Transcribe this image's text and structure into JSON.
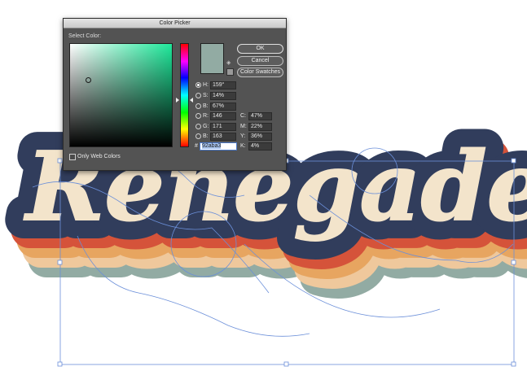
{
  "artwork": {
    "word": "Renegade",
    "colors": {
      "navy": "#313d5c",
      "cream": "#f3e4cb",
      "red": "#d5533a",
      "orange": "#e7a560",
      "tan": "#efc89c",
      "sage": "#92aba3",
      "selection": "#6b8fd9"
    }
  },
  "dialog": {
    "title": "Color Picker",
    "select_label": "Select Color:",
    "buttons": {
      "ok": "OK",
      "cancel": "Cancel",
      "swatches": "Color Swatches"
    },
    "current_color": "#92aba3",
    "hsb": [
      {
        "label": "H:",
        "value": "159°",
        "selected": true
      },
      {
        "label": "S:",
        "value": "14%",
        "selected": false
      },
      {
        "label": "B:",
        "value": "67%",
        "selected": false
      }
    ],
    "rgb": [
      {
        "label": "R:",
        "value": "146",
        "selected": false
      },
      {
        "label": "G:",
        "value": "171",
        "selected": false
      },
      {
        "label": "B:",
        "value": "163",
        "selected": false
      }
    ],
    "cmyk": [
      {
        "label": "C:",
        "value": "47%"
      },
      {
        "label": "M:",
        "value": "22%"
      },
      {
        "label": "Y:",
        "value": "36%"
      },
      {
        "label": "K:",
        "value": "4%"
      }
    ],
    "hex_prefix": "#",
    "hex": "92aba3",
    "only_web_colors": "Only Web Colors",
    "icons": {
      "gamut": "cube-icon",
      "web_safe": "small-swatch-icon"
    }
  }
}
